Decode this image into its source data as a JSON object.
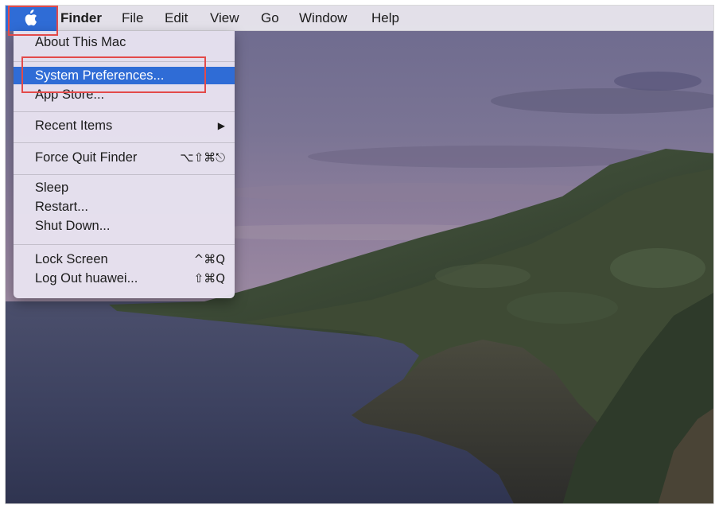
{
  "menubar": {
    "apple_icon": "apple-logo-icon",
    "items": [
      "Finder",
      "File",
      "Edit",
      "View",
      "Go",
      "Window",
      "Help"
    ]
  },
  "apple_menu": {
    "about": "About This Mac",
    "system_preferences": "System Preferences...",
    "app_store": "App Store...",
    "recent_items": "Recent Items",
    "recent_items_arrow": "▶",
    "force_quit": "Force Quit Finder",
    "force_quit_shortcut": "⌥⇧⌘⎋",
    "sleep": "Sleep",
    "restart": "Restart...",
    "shut_down": "Shut Down...",
    "lock_screen": "Lock Screen",
    "lock_screen_shortcut": "^⌘Q",
    "log_out": "Log Out huawei...",
    "log_out_shortcut": "⇧⌘Q"
  },
  "colors": {
    "highlight": "#2f6cd6",
    "annotation": "#e34a4a"
  }
}
